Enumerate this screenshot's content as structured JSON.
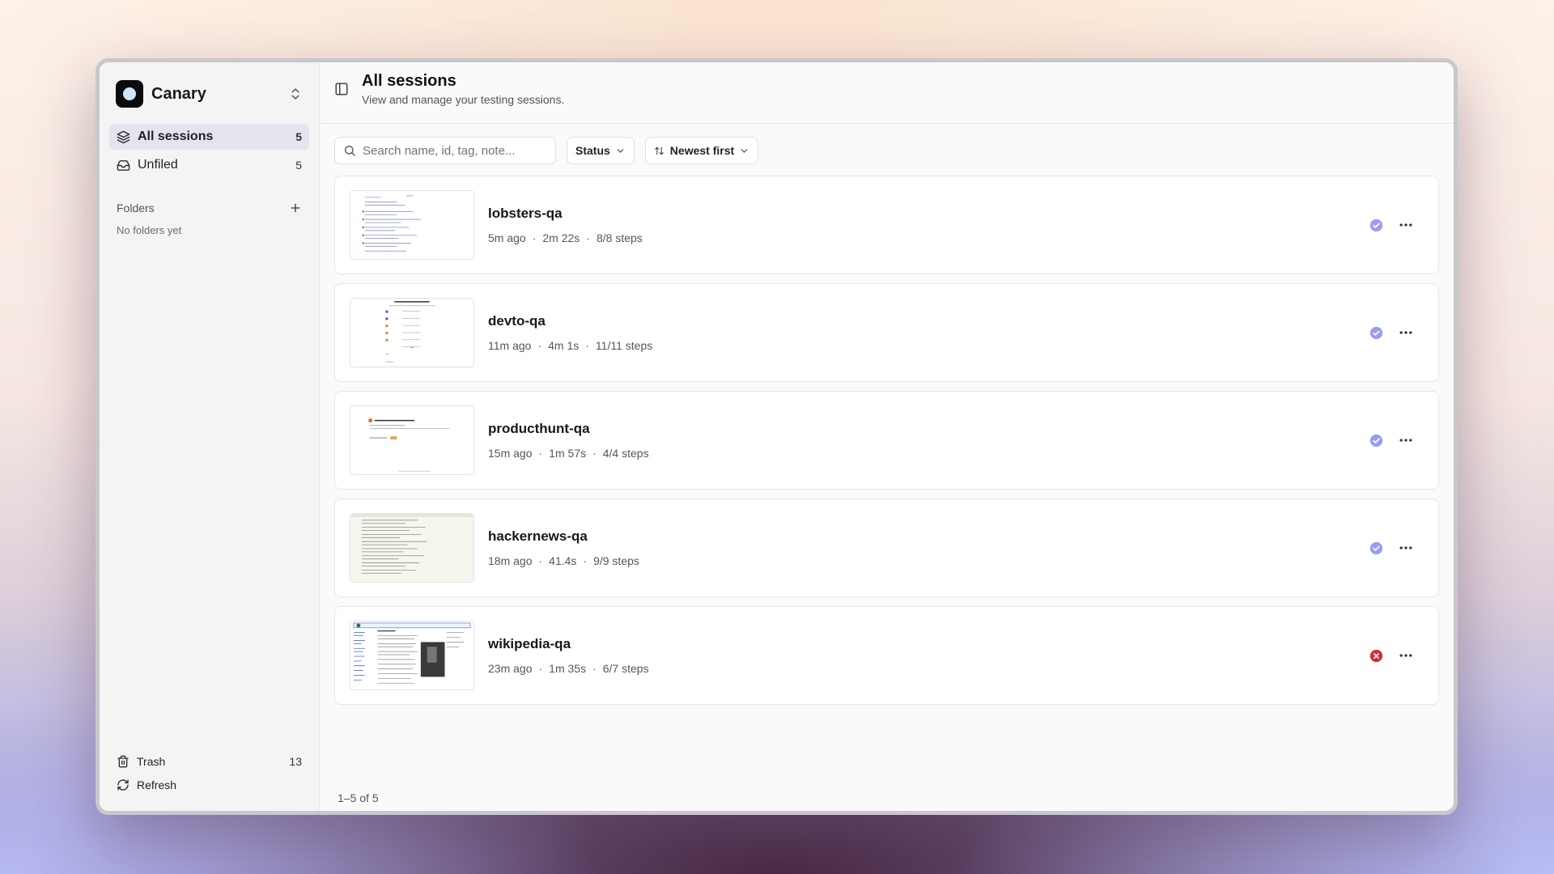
{
  "app": {
    "name": "Canary"
  },
  "sidebar": {
    "nav": [
      {
        "label": "All sessions",
        "count": "5",
        "icon": "layers-icon"
      },
      {
        "label": "Unfiled",
        "count": "5",
        "icon": "inbox-icon"
      }
    ],
    "folders": {
      "label": "Folders",
      "empty_text": "No folders yet"
    },
    "bottom": [
      {
        "label": "Trash",
        "count": "13",
        "icon": "trash-icon"
      },
      {
        "label": "Refresh",
        "icon": "refresh-icon"
      }
    ]
  },
  "header": {
    "title": "All sessions",
    "subtitle": "View and manage your testing sessions."
  },
  "toolbar": {
    "search_placeholder": "Search name, id, tag, note...",
    "status_label": "Status",
    "sort_label": "Newest first"
  },
  "sessions": [
    {
      "name": "lobsters-qa",
      "age": "5m ago",
      "duration": "2m 22s",
      "steps": "8/8 steps",
      "status": "passed"
    },
    {
      "name": "devto-qa",
      "age": "11m ago",
      "duration": "4m 1s",
      "steps": "11/11 steps",
      "status": "passed"
    },
    {
      "name": "producthunt-qa",
      "age": "15m ago",
      "duration": "1m 57s",
      "steps": "4/4 steps",
      "status": "passed"
    },
    {
      "name": "hackernews-qa",
      "age": "18m ago",
      "duration": "41.4s",
      "steps": "9/9 steps",
      "status": "passed"
    },
    {
      "name": "wikipedia-qa",
      "age": "23m ago",
      "duration": "1m 35s",
      "steps": "6/7 steps",
      "status": "failed"
    }
  ],
  "colors": {
    "passed": "#9a9cf0",
    "failed": "#d32f2f"
  },
  "pagination": {
    "text": "1–5 of 5"
  }
}
